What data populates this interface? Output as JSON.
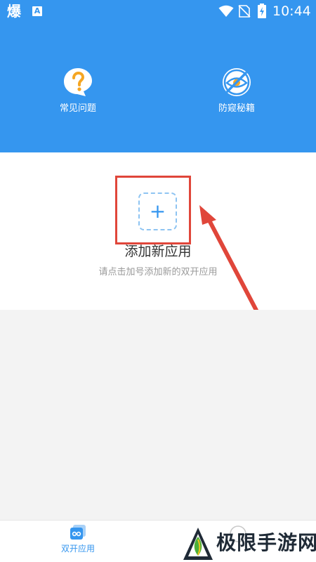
{
  "status_bar": {
    "time": "10:44",
    "app_icon_char": "爆",
    "notification_icon_char": "A"
  },
  "header": {
    "faq": {
      "label": "常见问题",
      "icon": "question-bubble-icon"
    },
    "anti_detect": {
      "label": "防窥秘籍",
      "icon": "no-eye-icon"
    }
  },
  "add_app": {
    "plus_symbol": "+",
    "title": "添加新应用",
    "subtitle": "请点击加号添加新的双开应用"
  },
  "bottom_nav": {
    "items": [
      {
        "label": "双开应用",
        "icon": "dual-app-icon",
        "active": true
      },
      {
        "label": "",
        "icon": "circle-icon",
        "active": false
      }
    ]
  },
  "watermark": {
    "text": "极限手游网"
  },
  "colors": {
    "primary": "#3596ef",
    "highlight": "#e0463a",
    "icon_bubble": "#f5a623"
  }
}
